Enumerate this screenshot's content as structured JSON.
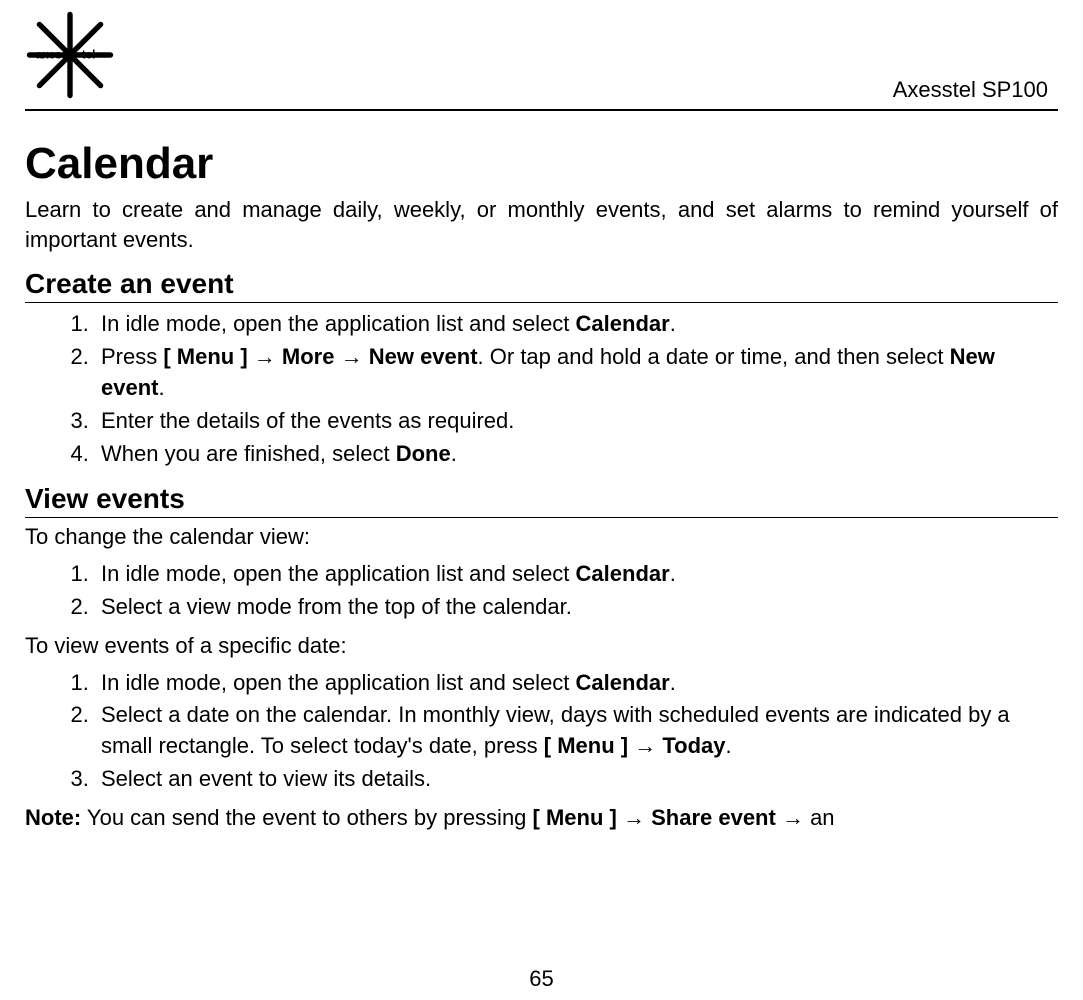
{
  "header": {
    "product": "Axesstel SP100",
    "logo_alt": "axess·tel logo"
  },
  "title": "Calendar",
  "intro": "Learn to create and manage daily, weekly, or monthly events, and set alarms to remind yourself of important events.",
  "section1": {
    "heading": "Create an event",
    "steps": {
      "s1_pre": "In idle mode, open the application list and select ",
      "s1_b1": "Calendar",
      "s1_post": ".",
      "s2_pre": "Press ",
      "s2_b1": "[ Menu ]",
      "s2_arr1": " → ",
      "s2_b2": "More",
      "s2_arr2": " → ",
      "s2_b3": "New event",
      "s2_mid": ". Or tap and hold a date or time, and then select ",
      "s2_b4": "New event",
      "s2_post": ".",
      "s3": "Enter the details of the events as required.",
      "s4_pre": "When you are finished, select ",
      "s4_b1": "Done",
      "s4_post": "."
    }
  },
  "section2": {
    "heading": "View events",
    "p1": "To change the calendar view:",
    "listA": {
      "a1_pre": "In idle mode, open the application list and select ",
      "a1_b1": "Calendar",
      "a1_post": ".",
      "a2": "Select a view mode from the top of the calendar."
    },
    "p2": "To view events of a specific date:",
    "listB": {
      "b1_pre": "In idle mode, open the application list and select ",
      "b1_b1": "Calendar",
      "b1_post": ".",
      "b2_pre": "Select a date on the calendar. In monthly view, days with scheduled events are indicated by a small rectangle. To select today's date, press ",
      "b2_b1": "[ Menu ]",
      "b2_arr": " → ",
      "b2_b2": "Today",
      "b2_post": ".",
      "b3": "Select an event to view its details."
    },
    "note": {
      "label": "Note:",
      "pre": " You can send the event to others by pressing ",
      "b1": "[ Menu ]",
      "arr1": " → ",
      "b2": "Share event",
      "arr2": " → ",
      "post": "an"
    }
  },
  "pagenum": "65"
}
